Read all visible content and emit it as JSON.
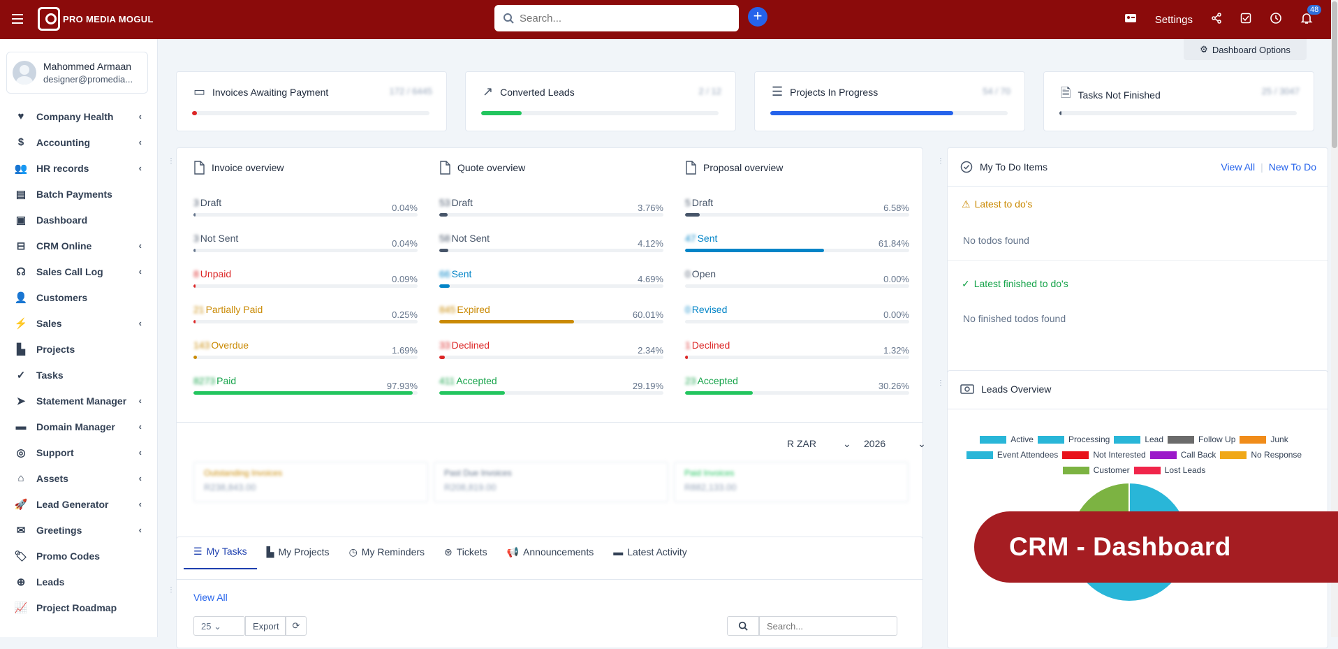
{
  "brand": {
    "name": "PRO MEDIA MOGUL"
  },
  "search": {
    "placeholder": "Search..."
  },
  "topbar": {
    "settings_label": "Settings",
    "notification_count": "48"
  },
  "profile": {
    "name": "Mahommed Armaan",
    "email": "designer@promedia..."
  },
  "sidebar": {
    "items": [
      {
        "label": "Company Health",
        "icon": "heartbeat-icon",
        "chevron": true
      },
      {
        "label": "Accounting",
        "icon": "dollar-icon",
        "chevron": true
      },
      {
        "label": "HR records",
        "icon": "users-icon",
        "chevron": true
      },
      {
        "label": "Batch Payments",
        "icon": "money-check-icon",
        "chevron": false
      },
      {
        "label": "Dashboard",
        "icon": "dashboard-icon",
        "chevron": false
      },
      {
        "label": "CRM Online",
        "icon": "inbox-icon",
        "chevron": true
      },
      {
        "label": "Sales Call Log",
        "icon": "headset-icon",
        "chevron": true
      },
      {
        "label": "Customers",
        "icon": "user-icon",
        "chevron": false
      },
      {
        "label": "Sales",
        "icon": "bolt-icon",
        "chevron": true
      },
      {
        "label": "Projects",
        "icon": "chart-icon",
        "chevron": false
      },
      {
        "label": "Tasks",
        "icon": "check-circle-icon",
        "chevron": false
      },
      {
        "label": "Statement Manager",
        "icon": "paper-plane-icon",
        "chevron": true
      },
      {
        "label": "Domain Manager",
        "icon": "server-icon",
        "chevron": true
      },
      {
        "label": "Support",
        "icon": "ticket-icon",
        "chevron": true
      },
      {
        "label": "Assets",
        "icon": "bank-icon",
        "chevron": true
      },
      {
        "label": "Lead Generator",
        "icon": "rocket-icon",
        "chevron": true
      },
      {
        "label": "Greetings",
        "icon": "envelope-icon",
        "chevron": true
      },
      {
        "label": "Promo Codes",
        "icon": "tag-icon",
        "chevron": false
      },
      {
        "label": "Leads",
        "icon": "crosshair-icon",
        "chevron": false
      },
      {
        "label": "Project Roadmap",
        "icon": "line-chart-icon",
        "chevron": false
      }
    ]
  },
  "dashboard_options": "Dashboard Options",
  "stats": [
    {
      "title": "Invoices Awaiting Payment",
      "value": "172 / 6445",
      "progress": 2,
      "color": "#dc2626",
      "icon": "money-icon"
    },
    {
      "title": "Converted Leads",
      "value": "2 / 12",
      "progress": 17,
      "color": "#22c55e",
      "icon": "trending-up-icon"
    },
    {
      "title": "Projects In Progress",
      "value": "54 / 70",
      "progress": 77,
      "color": "#2563eb",
      "icon": "sliders-icon"
    },
    {
      "title": "Tasks Not Finished",
      "value": "25 / 3047",
      "progress": 1,
      "color": "#475569",
      "icon": "file-check-icon"
    }
  ],
  "overviews": [
    {
      "title": "Invoice overview",
      "rows": [
        {
          "count": "3",
          "label": "Draft",
          "pct": "0.04%",
          "value": 0.04,
          "color": "#64748b",
          "text_color": "#475569"
        },
        {
          "count": "3",
          "label": "Not Sent",
          "pct": "0.04%",
          "value": 0.04,
          "color": "#64748b",
          "text_color": "#475569"
        },
        {
          "count": "8",
          "label": "Unpaid",
          "pct": "0.09%",
          "value": 0.09,
          "color": "#dc2626",
          "text_color": "#dc2626"
        },
        {
          "count": "21",
          "label": "Partially Paid",
          "pct": "0.25%",
          "value": 0.25,
          "color": "#dc2626",
          "text_color": "#ca8a04"
        },
        {
          "count": "143",
          "label": "Overdue",
          "pct": "1.69%",
          "value": 1.69,
          "color": "#ca8a04",
          "text_color": "#ca8a04"
        },
        {
          "count": "8273",
          "label": "Paid",
          "pct": "97.93%",
          "value": 97.93,
          "color": "#22c55e",
          "text_color": "#16a34a"
        }
      ]
    },
    {
      "title": "Quote overview",
      "rows": [
        {
          "count": "53",
          "label": "Draft",
          "pct": "3.76%",
          "value": 3.76,
          "color": "#475569",
          "text_color": "#475569"
        },
        {
          "count": "58",
          "label": "Not Sent",
          "pct": "4.12%",
          "value": 4.12,
          "color": "#475569",
          "text_color": "#475569"
        },
        {
          "count": "66",
          "label": "Sent",
          "pct": "4.69%",
          "value": 4.69,
          "color": "#0284c7",
          "text_color": "#0284c7"
        },
        {
          "count": "845",
          "label": "Expired",
          "pct": "60.01%",
          "value": 60.01,
          "color": "#ca8a04",
          "text_color": "#ca8a04"
        },
        {
          "count": "33",
          "label": "Declined",
          "pct": "2.34%",
          "value": 2.34,
          "color": "#dc2626",
          "text_color": "#dc2626"
        },
        {
          "count": "411",
          "label": "Accepted",
          "pct": "29.19%",
          "value": 29.19,
          "color": "#22c55e",
          "text_color": "#16a34a"
        }
      ]
    },
    {
      "title": "Proposal overview",
      "rows": [
        {
          "count": "5",
          "label": "Draft",
          "pct": "6.58%",
          "value": 6.58,
          "color": "#475569",
          "text_color": "#475569"
        },
        {
          "count": "47",
          "label": "Sent",
          "pct": "61.84%",
          "value": 61.84,
          "color": "#0284c7",
          "text_color": "#0284c7"
        },
        {
          "count": "0",
          "label": "Open",
          "pct": "0.00%",
          "value": 0,
          "color": "#475569",
          "text_color": "#475569"
        },
        {
          "count": "0",
          "label": "Revised",
          "pct": "0.00%",
          "value": 0,
          "color": "#0284c7",
          "text_color": "#0284c7"
        },
        {
          "count": "1",
          "label": "Declined",
          "pct": "1.32%",
          "value": 1.32,
          "color": "#dc2626",
          "text_color": "#dc2626"
        },
        {
          "count": "23",
          "label": "Accepted",
          "pct": "30.26%",
          "value": 30.26,
          "color": "#22c55e",
          "text_color": "#16a34a"
        }
      ]
    }
  ],
  "filters": {
    "currency": "R ZAR",
    "year": "2026"
  },
  "summaries": [
    {
      "title": "Outstanding Invoices",
      "value": "R238,843.00",
      "color": "#ca8a04"
    },
    {
      "title": "Past Due Invoices",
      "value": "R208,819.00",
      "color": "#64748b"
    },
    {
      "title": "Paid Invoices",
      "value": "R882,133.00",
      "color": "#22c55e"
    }
  ],
  "tabs": [
    {
      "label": "My Tasks",
      "icon": "tasks-icon",
      "active": true
    },
    {
      "label": "My Projects",
      "icon": "chart-icon",
      "active": false
    },
    {
      "label": "My Reminders",
      "icon": "clock-icon",
      "active": false
    },
    {
      "label": "Tickets",
      "icon": "lifebuoy-icon",
      "active": false
    },
    {
      "label": "Announcements",
      "icon": "bullhorn-icon",
      "active": false
    },
    {
      "label": "Latest Activity",
      "icon": "window-icon",
      "active": false
    }
  ],
  "tasks_panel": {
    "view_all": "View All",
    "page_size": "25",
    "export": "Export",
    "search_placeholder": "Search..."
  },
  "todo": {
    "title": "My To Do Items",
    "view_all": "View All",
    "new_todo": "New To Do",
    "latest_title": "Latest to do's",
    "latest_empty": "No todos found",
    "finished_title": "Latest finished to do's",
    "finished_empty": "No finished todos found"
  },
  "leads": {
    "title": "Leads Overview",
    "chart_data": {
      "type": "pie",
      "legend": [
        {
          "name": "Active",
          "color": "#29b6d8"
        },
        {
          "name": "Processing",
          "color": "#29b6d8"
        },
        {
          "name": "Lead",
          "color": "#29b6d8"
        },
        {
          "name": "Follow Up",
          "color": "#6b6b6b"
        },
        {
          "name": "Junk",
          "color": "#f08c1a"
        },
        {
          "name": "Event Attendees",
          "color": "#29b6d8"
        },
        {
          "name": "Not Interested",
          "color": "#e8131b"
        },
        {
          "name": "Call Back",
          "color": "#9b19c9"
        },
        {
          "name": "No Response",
          "color": "#f0a818"
        },
        {
          "name": "Customer",
          "color": "#7cb342"
        },
        {
          "name": "Lost Leads",
          "color": "#f0254a"
        }
      ],
      "slices": [
        {
          "name": "Active",
          "value": 75,
          "color": "#29b6d8"
        },
        {
          "name": "Customer",
          "value": 25,
          "color": "#7cb342"
        }
      ],
      "legend_position": "top"
    }
  },
  "promo_banner": "CRM - Dashboard"
}
